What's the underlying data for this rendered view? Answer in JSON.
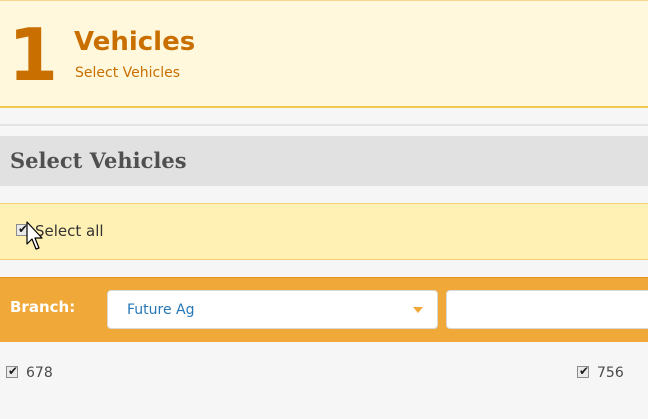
{
  "step": {
    "number": "1",
    "title": "Vehicles",
    "subtitle": "Select Vehicles"
  },
  "section": {
    "title": "Select Vehicles"
  },
  "select_all": {
    "label": "Select all",
    "checked": true
  },
  "branch_filter": {
    "label": "Branch:",
    "selected": "Future Ag",
    "search_value": ""
  },
  "vehicles": [
    {
      "label": "678",
      "checked": true
    },
    {
      "label": "756",
      "checked": true
    }
  ],
  "colors": {
    "accent": "#c96f00",
    "header_bg": "#fff8dc",
    "select_all_bg": "#fff1b3",
    "branch_bar": "#f0a838",
    "select_text": "#2677b6"
  },
  "icons": {
    "checkmark": "check-icon",
    "dropdown": "chevron-down-icon",
    "cursor": "mouse-pointer-icon"
  }
}
